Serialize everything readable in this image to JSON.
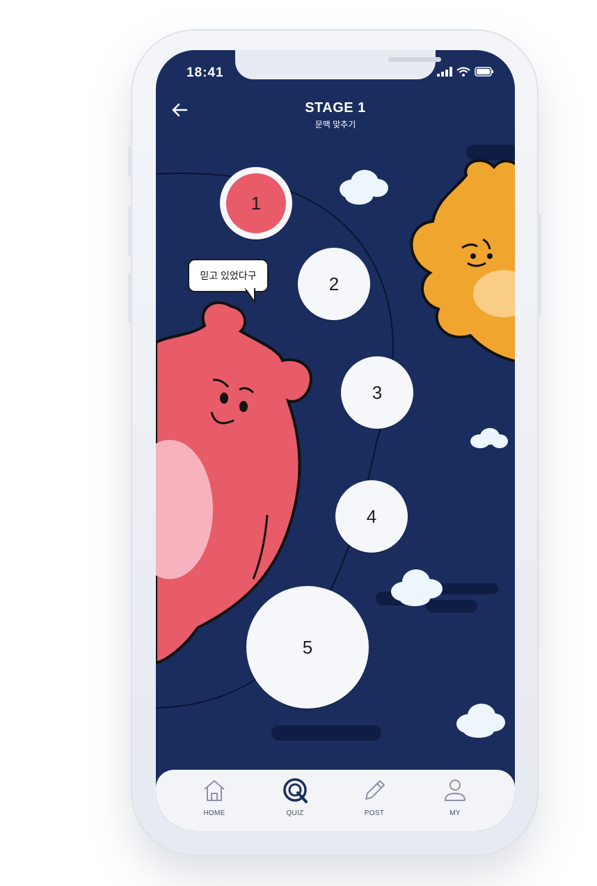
{
  "status_bar": {
    "time": "18:41"
  },
  "header": {
    "title": "STAGE 1",
    "subtitle": "문맥 맞추기"
  },
  "speech_bubble": {
    "text": "믿고 있었다구"
  },
  "stages": [
    {
      "label": "1",
      "state": "active"
    },
    {
      "label": "2",
      "state": "default"
    },
    {
      "label": "3",
      "state": "default"
    },
    {
      "label": "4",
      "state": "default"
    },
    {
      "label": "5",
      "state": "default"
    }
  ],
  "tabbar": {
    "items": [
      {
        "label": "HOME",
        "icon": "home-icon",
        "active": false
      },
      {
        "label": "QUIZ",
        "icon": "quiz-icon",
        "active": true
      },
      {
        "label": "POST",
        "icon": "pencil-icon",
        "active": false
      },
      {
        "label": "MY",
        "icon": "person-icon",
        "active": false
      }
    ]
  },
  "colors": {
    "background": "#1a2d5e",
    "active_stage": "#e85b69",
    "pink_bear": "#e85b69",
    "orange_bear": "#f0a52e",
    "tab_active": "#1a2d5e"
  }
}
